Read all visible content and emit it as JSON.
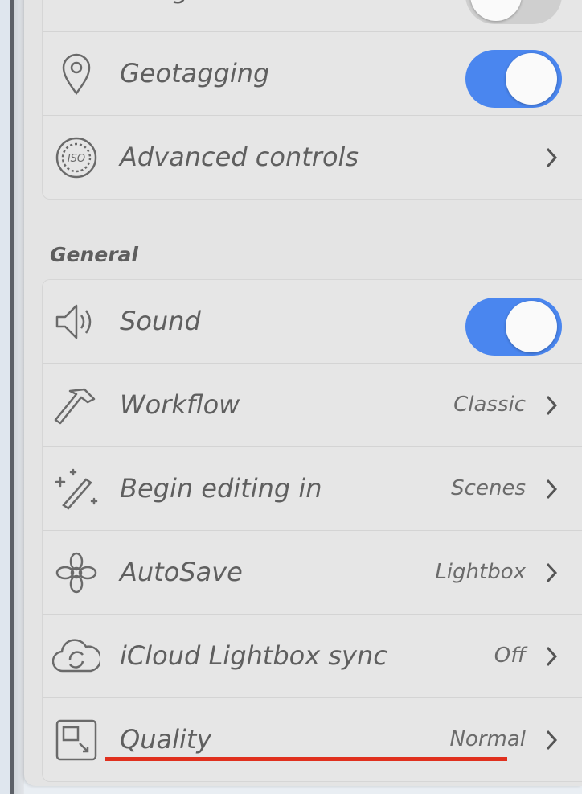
{
  "top_group": {
    "items": [
      {
        "label": "Horigon Level",
        "icon": "horizon-level-icon",
        "control": "toggle",
        "on": false
      },
      {
        "label": "Geotagging",
        "icon": "location-pin-icon",
        "control": "toggle",
        "on": true
      },
      {
        "label": "Advanced controls",
        "icon": "iso-icon",
        "control": "chevron"
      }
    ]
  },
  "general": {
    "title": "General",
    "items": [
      {
        "label": "Sound",
        "icon": "speaker-icon",
        "control": "toggle",
        "on": true
      },
      {
        "label": "Workflow",
        "value": "Classic",
        "icon": "hammer-icon",
        "control": "chevron"
      },
      {
        "label": "Begin editing in",
        "value": "Scenes",
        "icon": "magic-brush-icon",
        "control": "chevron"
      },
      {
        "label": "AutoSave",
        "value": "Lightbox",
        "icon": "flower-icon",
        "control": "chevron"
      },
      {
        "label": "iCloud Lightbox sync",
        "value": "Off",
        "icon": "cloud-sync-icon",
        "control": "chevron"
      },
      {
        "label": "Quality",
        "value": "Normal",
        "icon": "quality-resize-icon",
        "control": "chevron"
      }
    ]
  },
  "colors": {
    "toggle_on": "#4a86ef",
    "highlight_underline": "#e0301e"
  }
}
